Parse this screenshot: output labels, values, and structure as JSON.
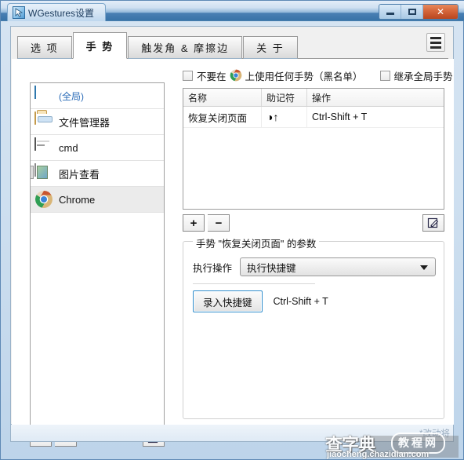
{
  "window": {
    "title": "WGestures设置",
    "app_icon": "cursor-arrow-icon",
    "controls": {
      "minimize": "minimize-icon",
      "maximize": "maximize-icon",
      "close": "✕"
    }
  },
  "tabs": [
    {
      "label": "选 项",
      "active": false
    },
    {
      "label": "手 势",
      "active": true
    },
    {
      "label": "触发角 & 摩擦边",
      "active": false
    },
    {
      "label": "关 于",
      "active": false
    }
  ],
  "menu_button": "hamburger-menu-icon",
  "app_list": [
    {
      "label": "(全局)",
      "icon": "global-cursor-icon",
      "selected": false,
      "is_global": true
    },
    {
      "label": "文件管理器",
      "icon": "folder-icon",
      "selected": false,
      "is_global": false
    },
    {
      "label": "cmd",
      "icon": "console-icon",
      "selected": false,
      "is_global": false
    },
    {
      "label": "图片查看",
      "icon": "image-viewer-icon",
      "selected": false,
      "is_global": false
    },
    {
      "label": "Chrome",
      "icon": "chrome-icon",
      "selected": true,
      "is_global": false
    }
  ],
  "app_list_tools": {
    "add": "+",
    "remove": "−",
    "edit": "pencil-edit-icon"
  },
  "blacklist_row": {
    "prefix_label": "不要在",
    "app_icon": "chrome-icon",
    "suffix_label": "上使用任何手势（黑名单）",
    "checked": false,
    "inherit_label": "继承全局手势",
    "inherit_checked": false
  },
  "gesture_table": {
    "columns": [
      "名称",
      "助记符",
      "操作"
    ],
    "rows": [
      {
        "name": "恢复关闭页面",
        "mnemonic": "◑↑",
        "action": "Ctrl-Shift + T"
      }
    ]
  },
  "table_tools": {
    "add": "+",
    "remove": "−",
    "edit": "pencil-edit-icon"
  },
  "param_group": {
    "legend": "手势 \"恢复关闭页面\" 的参数",
    "exec_label": "执行操作",
    "exec_value": "执行快捷键",
    "exec_options": [
      "执行快捷键"
    ],
    "record_button": "录入快捷键",
    "hotkey_value": "Ctrl-Shift + T"
  },
  "status_bar": {
    "text": "*改动将"
  },
  "watermark": {
    "chinese": "查字典",
    "pill": "教程网",
    "url": "jiaocheng.chazidian.com"
  },
  "colors": {
    "title_bar": "#3873a8",
    "close_button": "#b9461f",
    "accent_blue": "#2f8ccb",
    "global_text": "#2b6cb8",
    "selection": "#ebebeb"
  }
}
